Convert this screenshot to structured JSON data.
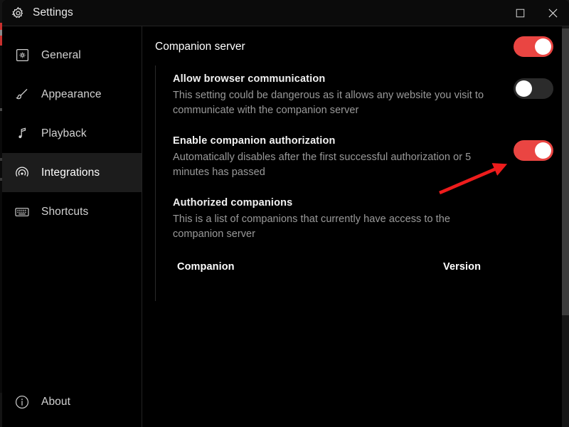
{
  "window": {
    "title": "Settings",
    "title_icon": "gear-icon",
    "controls": [
      {
        "name": "maximize-button",
        "icon": "square-icon"
      },
      {
        "name": "close-button",
        "icon": "close-x-icon"
      }
    ]
  },
  "sidebar": {
    "items": [
      {
        "label": "General",
        "icon": "gear-in-square-icon",
        "active": false
      },
      {
        "label": "Appearance",
        "icon": "paintbrush-icon",
        "active": false
      },
      {
        "label": "Playback",
        "icon": "music-note-icon",
        "active": false
      },
      {
        "label": "Integrations",
        "icon": "radar-signal-icon",
        "active": true
      },
      {
        "label": "Shortcuts",
        "icon": "keyboard-icon",
        "active": false
      }
    ],
    "footer": {
      "label": "About",
      "icon": "info-circle-icon"
    }
  },
  "main": {
    "section_title": "Companion server",
    "section_toggle": {
      "state": "on",
      "label": "Companion server toggle"
    },
    "settings": [
      {
        "name": "Allow browser communication",
        "description": "This setting could be dangerous as it allows any website you visit to communicate with the companion server",
        "toggle": "off"
      },
      {
        "name": "Enable companion authorization",
        "description": "Automatically disables after the first successful authorization or 5 minutes has passed",
        "toggle": "on"
      },
      {
        "name": "Authorized companions",
        "description": "This is a list of companions that currently have access to the companion server",
        "toggle": null
      }
    ],
    "table": {
      "columns": [
        "Companion",
        "Version"
      ],
      "rows": []
    }
  },
  "annotation": {
    "type": "arrow",
    "color": "#ee1c1c",
    "points_to": "enable-companion-authorization-toggle"
  },
  "colors": {
    "accent_red": "#ea4542",
    "window_bg": "#000000",
    "sidebar_active": "#1c1c1c",
    "titlebar_bg": "#0b0b0b",
    "text_primary": "#ffffff",
    "text_secondary": "#9a9a9a",
    "scrollbar_thumb": "#3c3c3c"
  }
}
